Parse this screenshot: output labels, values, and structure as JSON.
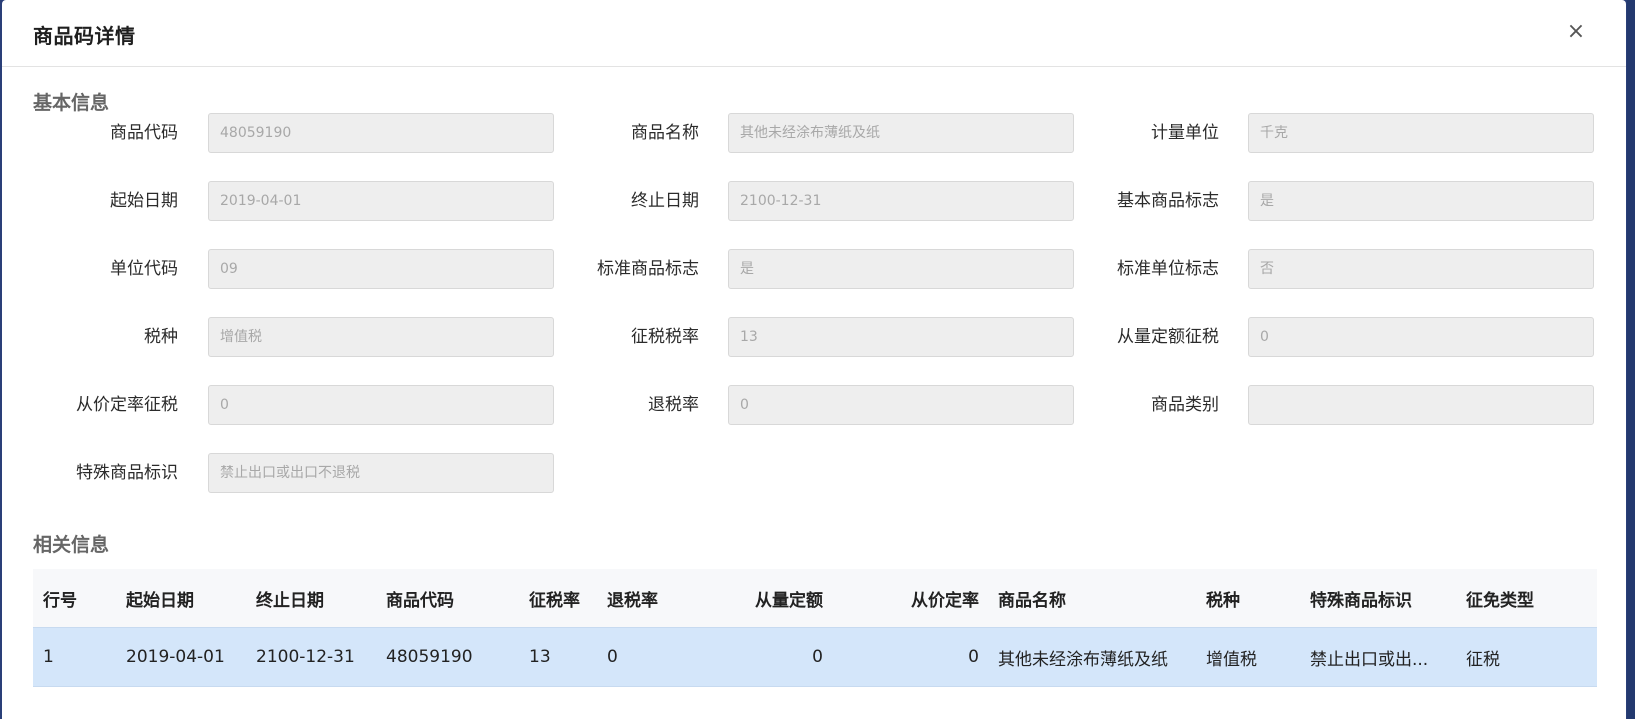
{
  "dialog": {
    "title": "商品码详情",
    "close_glyph": "×"
  },
  "basic_section": {
    "title": "基本信息"
  },
  "fields": {
    "goods_code": {
      "label": "商品代码",
      "value": "48059190"
    },
    "goods_name": {
      "label": "商品名称",
      "value": "其他未经涂布薄纸及纸"
    },
    "unit": {
      "label": "计量单位",
      "value": "千克"
    },
    "start_date": {
      "label": "起始日期",
      "value": "2019-04-01"
    },
    "end_date": {
      "label": "终止日期",
      "value": "2100-12-31"
    },
    "basic_goods_flag": {
      "label": "基本商品标志",
      "value": "是"
    },
    "unit_code": {
      "label": "单位代码",
      "value": "09"
    },
    "standard_goods_flag": {
      "label": "标准商品标志",
      "value": "是"
    },
    "standard_unit_flag": {
      "label": "标准单位标志",
      "value": "否"
    },
    "tax_type": {
      "label": "税种",
      "value": "增值税"
    },
    "tax_rate": {
      "label": "征税税率",
      "value": "13"
    },
    "specific_quota_tax": {
      "label": "从量定额征税",
      "value": "0"
    },
    "ad_valorem_tax": {
      "label": "从价定率征税",
      "value": "0"
    },
    "refund_rate": {
      "label": "退税率",
      "value": "0"
    },
    "goods_category": {
      "label": "商品类别",
      "value": ""
    },
    "special_goods_mark": {
      "label": "特殊商品标识",
      "value": "禁止出口或出口不退税"
    }
  },
  "related_section": {
    "title": "相关信息"
  },
  "table": {
    "headers": [
      "行号",
      "起始日期",
      "终止日期",
      "商品代码",
      "征税率",
      "退税率",
      "从量定额",
      "从价定率",
      "商品名称",
      "税种",
      "特殊商品标识",
      "征免类型"
    ],
    "rows": [
      [
        "1",
        "2019-04-01",
        "2100-12-31",
        "48059190",
        "13",
        "0",
        "0",
        "0",
        "其他未经涂布薄纸及纸",
        "增值税",
        "禁止出口或出...",
        "征税"
      ]
    ]
  }
}
